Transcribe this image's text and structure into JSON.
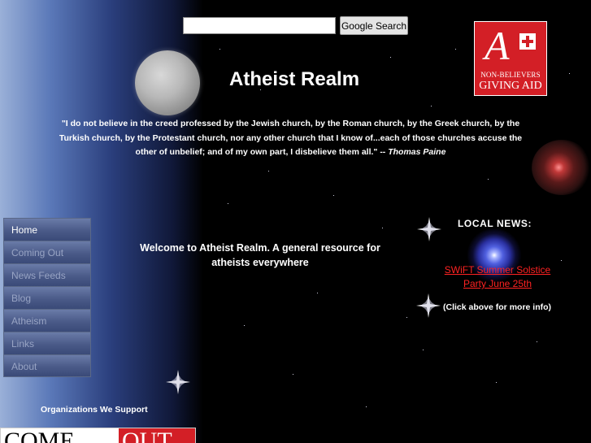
{
  "search": {
    "placeholder": "",
    "value": "",
    "button_label": "Google Search"
  },
  "header": {
    "title": "Atheist Realm"
  },
  "logo": {
    "mark": "A",
    "line1": "NON-BELIEVERS",
    "line2": "GIVING AID"
  },
  "quote": {
    "text": "\"I do not believe in the creed professed by the Jewish church, by the Roman church, by the Greek church, by the Turkish church, by the Protestant church, nor any other church that I know of...each of those churches accuse the other of unbelief; and of my own part, I disbelieve them all.\"  --",
    "author": "Thomas Paine"
  },
  "nav": {
    "items": [
      {
        "label": "Home"
      },
      {
        "label": "Coming Out"
      },
      {
        "label": "News Feeds"
      },
      {
        "label": "Blog"
      },
      {
        "label": "Atheism"
      },
      {
        "label": "Links"
      },
      {
        "label": "About"
      }
    ]
  },
  "welcome": {
    "text": "Welcome to Atheist Realm. A general resource for atheists everywhere"
  },
  "local_news": {
    "title": "LOCAL  NEWS:",
    "link_text": "SWiFT Summer Solstice Party June 25th",
    "info": "(Click above for more info)"
  },
  "organizations": {
    "title": "Organizations We Support",
    "banner_word1": "COME",
    "banner_word2": "OUT"
  },
  "colors": {
    "accent_red": "#d31f26",
    "link_red": "#ff2222",
    "nav_blue": "#4a5a88"
  }
}
